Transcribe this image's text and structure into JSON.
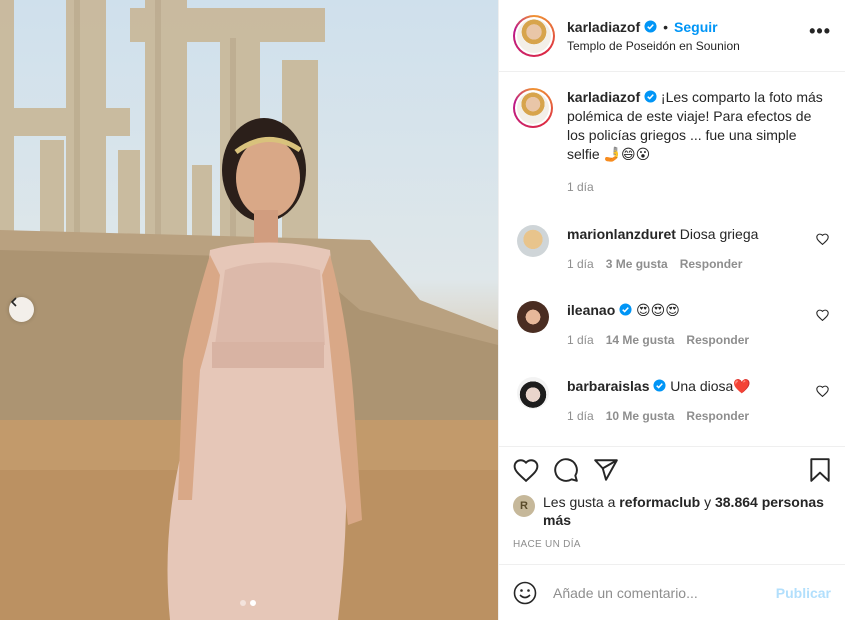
{
  "header": {
    "username": "karladiazof",
    "separator": "•",
    "follow_label": "Seguir",
    "location": "Templo de Poseidón en Sounion",
    "more_label": "•••"
  },
  "caption": {
    "username": "karladiazof",
    "text": "¡Les comparto la foto más polémica de este viaje! Para efectos de los policías griegos ... fue una simple selfie 🤳😄😮",
    "time": "1 día"
  },
  "comments": [
    {
      "username": "marionlanzduret",
      "text": "Diosa griega",
      "time": "1 día",
      "likes": "3 Me gusta",
      "reply": "Responder",
      "verified": false
    },
    {
      "username": "ileanao",
      "text": "😍😍😍",
      "time": "1 día",
      "likes": "14 Me gusta",
      "reply": "Responder",
      "verified": true
    },
    {
      "username": "barbaraislas",
      "text": "Una diosa❤️",
      "time": "1 día",
      "likes": "10 Me gusta",
      "reply": "Responder",
      "verified": true
    }
  ],
  "likes": {
    "prefix": "Les gusta a",
    "user": "reformaclub",
    "conj": "y",
    "others": "38.864 personas más",
    "avatar_letter": "R"
  },
  "timestamp": "HACE UN DÍA",
  "add_comment": {
    "placeholder": "Añade un comentario...",
    "publish_label": "Publicar"
  },
  "carousel": {
    "total": 2,
    "current": 2
  },
  "colors": {
    "link": "#0095f6",
    "publish_disabled": "#b2dffc",
    "muted": "#8e8e8e"
  }
}
